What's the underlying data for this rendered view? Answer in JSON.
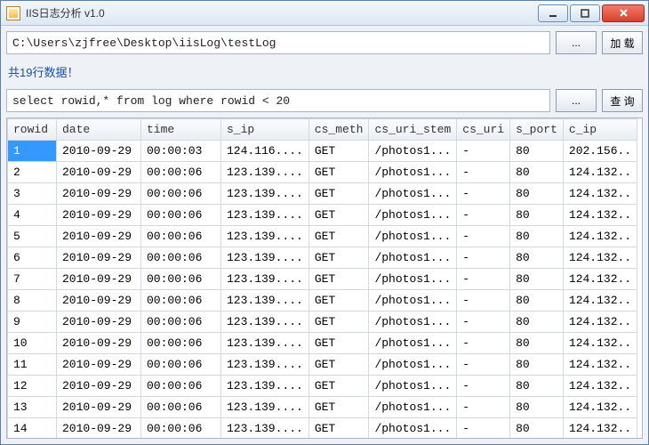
{
  "window": {
    "title": "IIS日志分析 v1.0"
  },
  "toolbar": {
    "path_value": "C:\\Users\\zjfree\\Desktop\\iisLog\\testLog",
    "browse_label": "...",
    "load_label": "加 载"
  },
  "status": {
    "text": "共19行数据！"
  },
  "query": {
    "sql_value": "select rowid,* from log where rowid < 20",
    "browse_label": "...",
    "run_label": "查 询"
  },
  "table": {
    "columns": [
      "rowid",
      "date",
      "time",
      "s_ip",
      "cs_meth",
      "cs_uri_stem",
      "cs_uri",
      "s_port",
      "c_ip"
    ],
    "rows": [
      {
        "rowid": "1",
        "date": "2010-09-29",
        "time": "00:00:03",
        "s_ip": "124.116....",
        "cs_meth": "GET",
        "cs_uri_stem": "/photos1...",
        "cs_uri": "-",
        "s_port": "80",
        "c_ip": "202.156.."
      },
      {
        "rowid": "2",
        "date": "2010-09-29",
        "time": "00:00:06",
        "s_ip": "123.139....",
        "cs_meth": "GET",
        "cs_uri_stem": "/photos1...",
        "cs_uri": "-",
        "s_port": "80",
        "c_ip": "124.132.."
      },
      {
        "rowid": "3",
        "date": "2010-09-29",
        "time": "00:00:06",
        "s_ip": "123.139....",
        "cs_meth": "GET",
        "cs_uri_stem": "/photos1...",
        "cs_uri": "-",
        "s_port": "80",
        "c_ip": "124.132.."
      },
      {
        "rowid": "4",
        "date": "2010-09-29",
        "time": "00:00:06",
        "s_ip": "123.139....",
        "cs_meth": "GET",
        "cs_uri_stem": "/photos1...",
        "cs_uri": "-",
        "s_port": "80",
        "c_ip": "124.132.."
      },
      {
        "rowid": "5",
        "date": "2010-09-29",
        "time": "00:00:06",
        "s_ip": "123.139....",
        "cs_meth": "GET",
        "cs_uri_stem": "/photos1...",
        "cs_uri": "-",
        "s_port": "80",
        "c_ip": "124.132.."
      },
      {
        "rowid": "6",
        "date": "2010-09-29",
        "time": "00:00:06",
        "s_ip": "123.139....",
        "cs_meth": "GET",
        "cs_uri_stem": "/photos1...",
        "cs_uri": "-",
        "s_port": "80",
        "c_ip": "124.132.."
      },
      {
        "rowid": "7",
        "date": "2010-09-29",
        "time": "00:00:06",
        "s_ip": "123.139....",
        "cs_meth": "GET",
        "cs_uri_stem": "/photos1...",
        "cs_uri": "-",
        "s_port": "80",
        "c_ip": "124.132.."
      },
      {
        "rowid": "8",
        "date": "2010-09-29",
        "time": "00:00:06",
        "s_ip": "123.139....",
        "cs_meth": "GET",
        "cs_uri_stem": "/photos1...",
        "cs_uri": "-",
        "s_port": "80",
        "c_ip": "124.132.."
      },
      {
        "rowid": "9",
        "date": "2010-09-29",
        "time": "00:00:06",
        "s_ip": "123.139....",
        "cs_meth": "GET",
        "cs_uri_stem": "/photos1...",
        "cs_uri": "-",
        "s_port": "80",
        "c_ip": "124.132.."
      },
      {
        "rowid": "10",
        "date": "2010-09-29",
        "time": "00:00:06",
        "s_ip": "123.139....",
        "cs_meth": "GET",
        "cs_uri_stem": "/photos1...",
        "cs_uri": "-",
        "s_port": "80",
        "c_ip": "124.132.."
      },
      {
        "rowid": "11",
        "date": "2010-09-29",
        "time": "00:00:06",
        "s_ip": "123.139....",
        "cs_meth": "GET",
        "cs_uri_stem": "/photos1...",
        "cs_uri": "-",
        "s_port": "80",
        "c_ip": "124.132.."
      },
      {
        "rowid": "12",
        "date": "2010-09-29",
        "time": "00:00:06",
        "s_ip": "123.139....",
        "cs_meth": "GET",
        "cs_uri_stem": "/photos1...",
        "cs_uri": "-",
        "s_port": "80",
        "c_ip": "124.132.."
      },
      {
        "rowid": "13",
        "date": "2010-09-29",
        "time": "00:00:06",
        "s_ip": "123.139....",
        "cs_meth": "GET",
        "cs_uri_stem": "/photos1...",
        "cs_uri": "-",
        "s_port": "80",
        "c_ip": "124.132.."
      },
      {
        "rowid": "14",
        "date": "2010-09-29",
        "time": "00:00:06",
        "s_ip": "123.139....",
        "cs_meth": "GET",
        "cs_uri_stem": "/photos1...",
        "cs_uri": "-",
        "s_port": "80",
        "c_ip": "124.132.."
      }
    ],
    "selected_row_index": 0
  }
}
